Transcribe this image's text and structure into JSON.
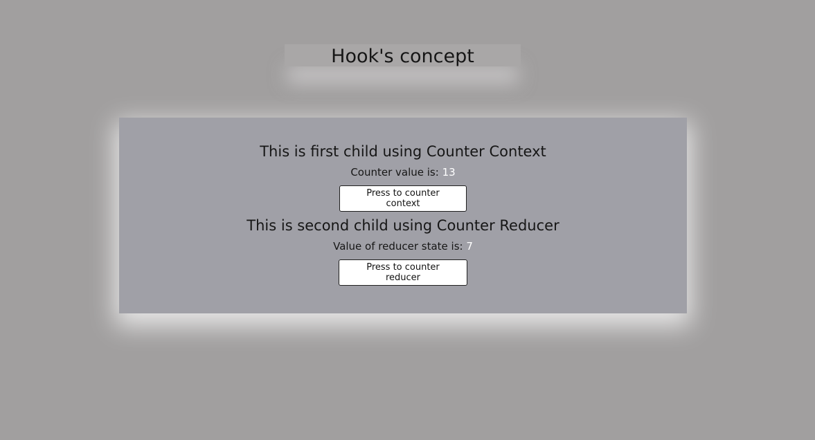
{
  "header": {
    "title": "Hook's concept"
  },
  "first_child": {
    "heading": "This is first child using Counter Context",
    "value_label": "Counter value is: ",
    "value": "13",
    "button_label": "Press to counter context"
  },
  "second_child": {
    "heading": "This is second child using Counter Reducer",
    "value_label": "Value of reducer state is: ",
    "value": "7",
    "button_label": "Press to counter reducer"
  },
  "colors": {
    "page_background": "#a19f9f",
    "panel_background": "#a0a0a7",
    "value_highlight": "#ffffff"
  }
}
